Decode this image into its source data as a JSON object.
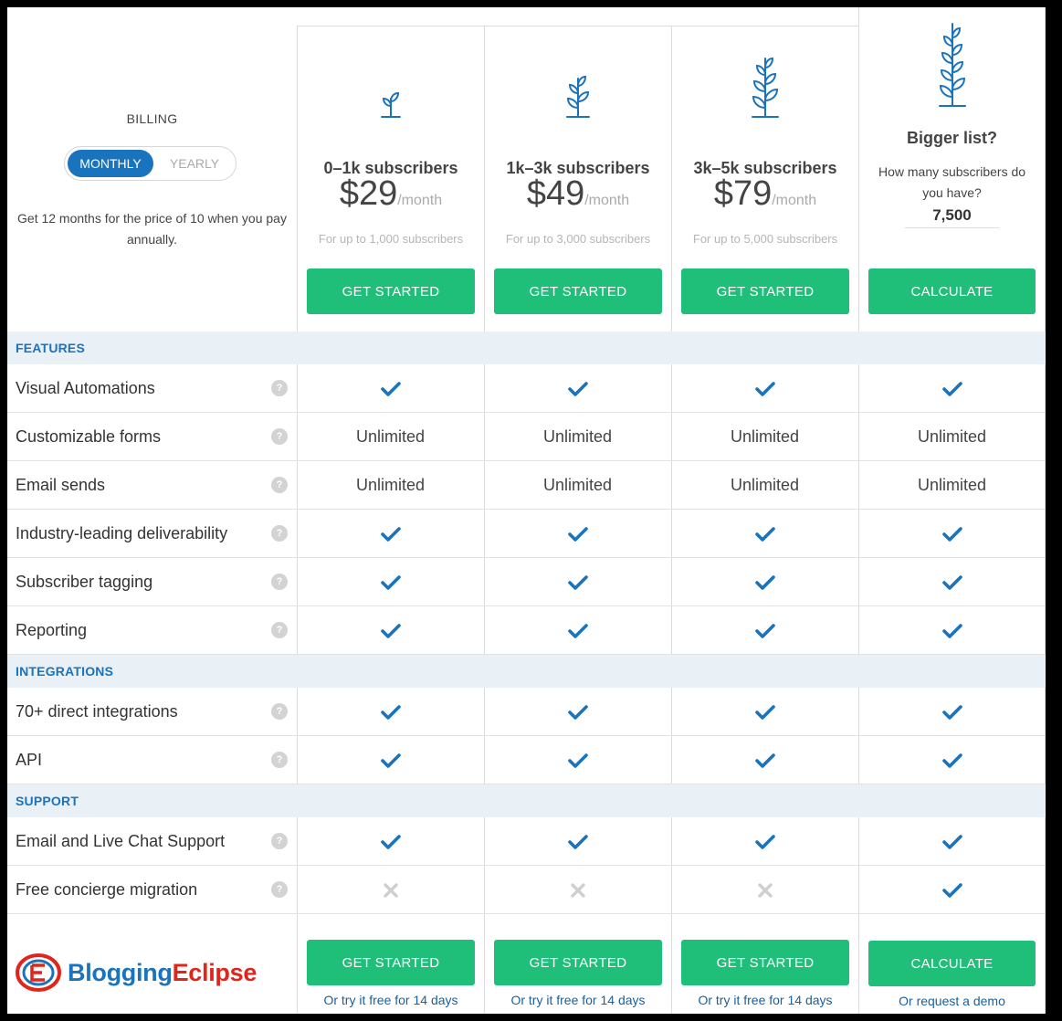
{
  "billing": {
    "title": "BILLING",
    "monthly_label": "MONTHLY",
    "yearly_label": "YEARLY",
    "selected": "MONTHLY",
    "note": "Get 12 months for the price of 10 when you pay annually."
  },
  "plans": [
    {
      "name": "0–1k subscribers",
      "price": "$29",
      "per": "/month",
      "limit": "For up to 1,000 subscribers",
      "button": "GET STARTED",
      "footer_button": "GET STARTED",
      "footer_link": "Or try it free for 14 days"
    },
    {
      "name": "1k–3k subscribers",
      "price": "$49",
      "per": "/month",
      "limit": "For up to 3,000 subscribers",
      "button": "GET STARTED",
      "footer_button": "GET STARTED",
      "footer_link": "Or try it free for 14 days"
    },
    {
      "name": "3k–5k subscribers",
      "price": "$79",
      "per": "/month",
      "limit": "For up to 5,000 subscribers",
      "button": "GET STARTED",
      "footer_button": "GET STARTED",
      "footer_link": "Or try it free for 14 days"
    }
  ],
  "bigger": {
    "title": "Bigger list?",
    "question": "How many subscribers do you have?",
    "value": "7,500",
    "button": "CALCULATE",
    "footer_button": "CALCULATE",
    "footer_link": "Or request a demo"
  },
  "sections": [
    {
      "title": "FEATURES",
      "rows": [
        {
          "label": "Visual Automations",
          "cells": [
            "check",
            "check",
            "check",
            "check"
          ]
        },
        {
          "label": "Customizable forms",
          "cells": [
            "Unlimited",
            "Unlimited",
            "Unlimited",
            "Unlimited"
          ]
        },
        {
          "label": "Email sends",
          "cells": [
            "Unlimited",
            "Unlimited",
            "Unlimited",
            "Unlimited"
          ]
        },
        {
          "label": "Industry-leading deliverability",
          "cells": [
            "check",
            "check",
            "check",
            "check"
          ]
        },
        {
          "label": "Subscriber tagging",
          "cells": [
            "check",
            "check",
            "check",
            "check"
          ]
        },
        {
          "label": "Reporting",
          "cells": [
            "check",
            "check",
            "check",
            "check"
          ]
        }
      ]
    },
    {
      "title": "INTEGRATIONS",
      "rows": [
        {
          "label": "70+ direct integrations",
          "cells": [
            "check",
            "check",
            "check",
            "check"
          ]
        },
        {
          "label": "API",
          "cells": [
            "check",
            "check",
            "check",
            "check"
          ]
        }
      ]
    },
    {
      "title": "SUPPORT",
      "rows": [
        {
          "label": "Email and Live Chat Support",
          "cells": [
            "check",
            "check",
            "check",
            "check"
          ]
        },
        {
          "label": "Free concierge migration",
          "cells": [
            "cross",
            "cross",
            "cross",
            "check"
          ]
        }
      ]
    }
  ],
  "help_icon_glyph": "?",
  "logo": {
    "part1": "Blogging",
    "part2": "Eclipse",
    "color1": "#1a73bd",
    "color2": "#e1251b"
  },
  "colors": {
    "accent_blue": "#1a73bd",
    "button_green": "#1fbe79",
    "section_bg": "#e9f0f6",
    "cross_gray": "#cfcfcf"
  }
}
